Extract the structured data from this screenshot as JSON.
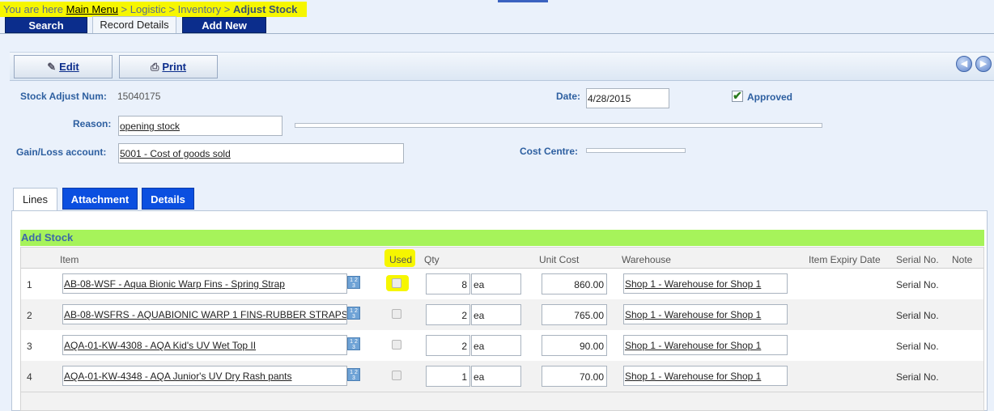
{
  "breadcrumb": {
    "prefix": "You are here",
    "main_menu": "Main Menu",
    "path": "> Logistic > Inventory >",
    "current": "Adjust Stock"
  },
  "top_tabs": {
    "search": "Search",
    "record_details": "Record Details",
    "add_new": "Add New"
  },
  "toolbar": {
    "edit": "Edit",
    "print": "Print"
  },
  "form": {
    "stock_adjust_num_label": "Stock Adjust Num:",
    "stock_adjust_num": "15040175",
    "date_label": "Date:",
    "date": "4/28/2015",
    "approved_label": "Approved",
    "approved": true,
    "reason_label": "Reason:",
    "reason": "opening stock",
    "gain_loss_label": "Gain/Loss account:",
    "gain_loss": "5001 - Cost of goods sold",
    "cost_centre_label": "Cost Centre:",
    "cost_centre": ""
  },
  "lower_tabs": {
    "lines": "Lines",
    "attachment": "Attachment",
    "details": "Details"
  },
  "section": {
    "add_stock": "Add Stock"
  },
  "columns": {
    "item": "Item",
    "used": "Used",
    "qty": "Qty",
    "unit_cost": "Unit Cost",
    "warehouse": "Warehouse",
    "expiry": "Item Expiry Date",
    "serial": "Serial No.",
    "note": "Note"
  },
  "rows": [
    {
      "num": "1",
      "item": "AB-08-WSF - Aqua Bionic Warp Fins - Spring Strap",
      "qty": "8",
      "uom": "ea",
      "unit_cost": "860.00",
      "warehouse": "Shop 1 - Warehouse for Shop 1",
      "serial": "Serial No."
    },
    {
      "num": "2",
      "item": "AB-08-WSFRS - AQUABIONIC WARP 1 FINS-RUBBER STRAPS",
      "qty": "2",
      "uom": "ea",
      "unit_cost": "765.00",
      "warehouse": "Shop 1 - Warehouse for Shop 1",
      "serial": "Serial No."
    },
    {
      "num": "3",
      "item": "AQA-01-KW-4308 - AQA Kid's UV Wet Top II",
      "qty": "2",
      "uom": "ea",
      "unit_cost": "90.00",
      "warehouse": "Shop 1 - Warehouse for Shop 1",
      "serial": "Serial No."
    },
    {
      "num": "4",
      "item": "AQA-01-KW-4348 - AQA Junior's UV Dry Rash pants",
      "qty": "1",
      "uom": "ea",
      "unit_cost": "70.00",
      "warehouse": "Shop 1 - Warehouse for Shop 1",
      "serial": "Serial No."
    }
  ],
  "colors": {
    "accent_dark": "#0b2d8c",
    "tab_blue": "#0b4fe0",
    "highlight": "#f6f600",
    "add_bar": "#a6f35a",
    "label": "#2d5fa0"
  }
}
